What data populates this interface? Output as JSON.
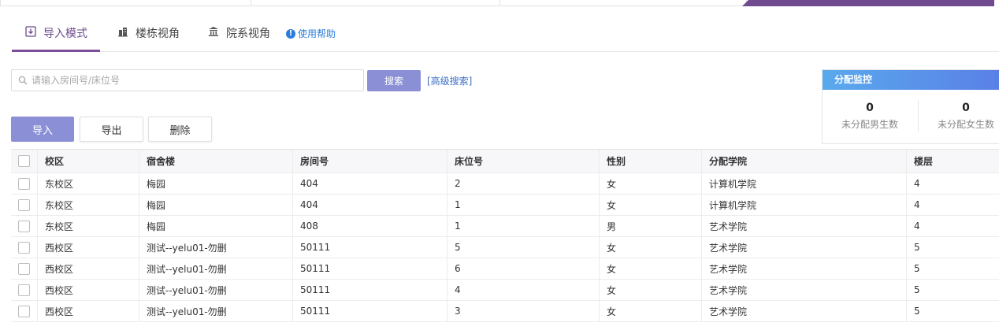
{
  "tabs": [
    {
      "label": "导入模式",
      "icon": "import-icon"
    },
    {
      "label": "楼栋视角",
      "icon": "building-icon"
    },
    {
      "label": "院系视角",
      "icon": "institution-icon"
    }
  ],
  "help": {
    "label": "使用帮助",
    "icon": "info-icon"
  },
  "search": {
    "placeholder": "请输入房间号/床位号",
    "value": "",
    "button_label": "搜索",
    "advanced_label": "[高级搜索]"
  },
  "monitor": {
    "title": "分配监控",
    "male": {
      "value": "0",
      "label": "未分配男生数"
    },
    "female": {
      "value": "0",
      "label": "未分配女生数"
    }
  },
  "actions": {
    "import": "导入",
    "export": "导出",
    "delete": "删除"
  },
  "table": {
    "headers": [
      "校区",
      "宿舍楼",
      "房间号",
      "床位号",
      "性别",
      "分配学院",
      "楼层"
    ],
    "rows": [
      [
        "东校区",
        "梅园",
        "404",
        "2",
        "女",
        "计算机学院",
        "4"
      ],
      [
        "东校区",
        "梅园",
        "404",
        "1",
        "女",
        "计算机学院",
        "4"
      ],
      [
        "东校区",
        "梅园",
        "408",
        "1",
        "男",
        "艺术学院",
        "4"
      ],
      [
        "西校区",
        "测试--yelu01-勿删",
        "50111",
        "5",
        "女",
        "艺术学院",
        "5"
      ],
      [
        "西校区",
        "测试--yelu01-勿删",
        "50111",
        "6",
        "女",
        "艺术学院",
        "5"
      ],
      [
        "西校区",
        "测试--yelu01-勿删",
        "50111",
        "4",
        "女",
        "艺术学院",
        "5"
      ],
      [
        "西校区",
        "测试--yelu01-勿删",
        "50111",
        "3",
        "女",
        "艺术学院",
        "5"
      ]
    ]
  },
  "colors": {
    "accent": "#7b4f9b",
    "primary_button": "#8b90d6",
    "link": "#2a7ddb"
  }
}
